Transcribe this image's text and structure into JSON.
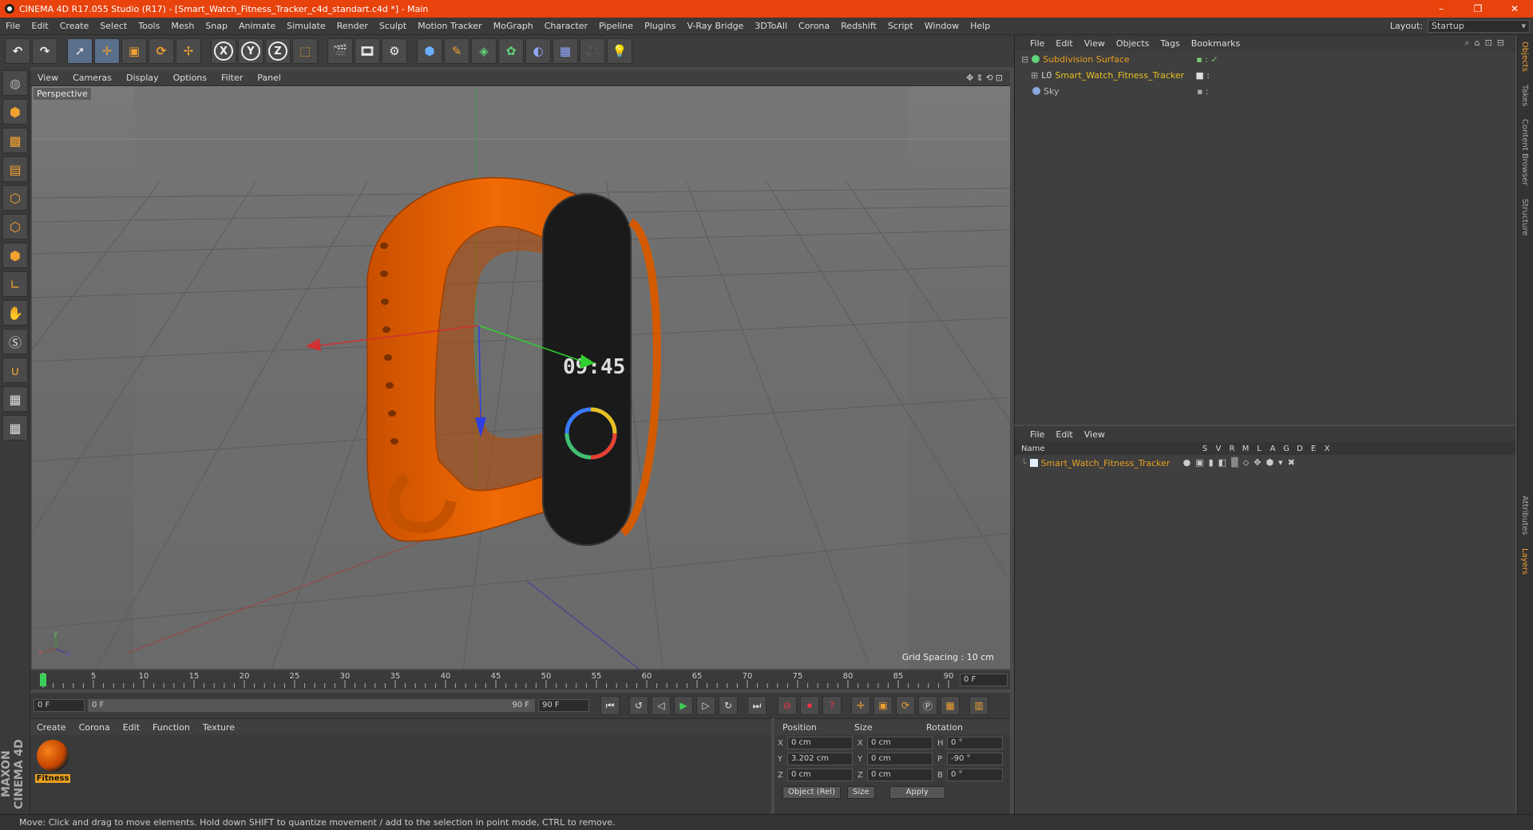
{
  "window": {
    "title": "CINEMA 4D R17.055 Studio (R17) - [Smart_Watch_Fitness_Tracker_c4d_standart.c4d *] - Main",
    "min": "–",
    "max": "❐",
    "close": "✕"
  },
  "menubar": {
    "items": [
      "File",
      "Edit",
      "Create",
      "Select",
      "Tools",
      "Mesh",
      "Snap",
      "Animate",
      "Simulate",
      "Render",
      "Sculpt",
      "Motion Tracker",
      "MoGraph",
      "Character",
      "Pipeline",
      "Plugins",
      "V-Ray Bridge",
      "3DToAll",
      "Corona",
      "Redshift",
      "Script",
      "Window",
      "Help"
    ],
    "layout_label": "Layout:",
    "layout_value": "Startup"
  },
  "toolbar": {
    "x": "X",
    "y": "Y",
    "z": "Z"
  },
  "viewport": {
    "menu": [
      "View",
      "Cameras",
      "Display",
      "Options",
      "Filter",
      "Panel"
    ],
    "camera": "Perspective",
    "grid_spacing": "Grid Spacing : 10 cm",
    "watch_time": "09:45"
  },
  "timeline": {
    "ticks": [
      "0",
      "5",
      "10",
      "15",
      "20",
      "25",
      "30",
      "35",
      "40",
      "45",
      "50",
      "55",
      "60",
      "65",
      "70",
      "75",
      "80",
      "85",
      "90"
    ],
    "end_field": "0 F",
    "start_frame": "0 F",
    "range_start": "0 F",
    "range_end": "90 F",
    "max_frame": "90 F"
  },
  "material_manager": {
    "menu": [
      "Create",
      "Corona",
      "Edit",
      "Function",
      "Texture"
    ],
    "material_name": "Fitness"
  },
  "coordinates": {
    "headers": [
      "Position",
      "Size",
      "Rotation"
    ],
    "rows": [
      {
        "pos_axis": "X",
        "pos": "0 cm",
        "size_axis": "X",
        "size": "0 cm",
        "rot_axis": "H",
        "rot": "0 °"
      },
      {
        "pos_axis": "Y",
        "pos": "3.202 cm",
        "size_axis": "Y",
        "size": "0 cm",
        "rot_axis": "P",
        "rot": "-90 °"
      },
      {
        "pos_axis": "Z",
        "pos": "0 cm",
        "size_axis": "Z",
        "size": "0 cm",
        "rot_axis": "B",
        "rot": "0 °"
      }
    ],
    "mode": "Object (Rel)",
    "size_mode": "Size",
    "apply": "Apply"
  },
  "object_manager": {
    "menu": [
      "File",
      "Edit",
      "View",
      "Objects",
      "Tags",
      "Bookmarks"
    ],
    "objects": [
      {
        "name": "Subdivision Surface",
        "color": "#e8a020"
      },
      {
        "name": "Smart_Watch_Fitness_Tracker",
        "color": "#e8c020"
      },
      {
        "name": "Sky",
        "color": "#bbbbbb"
      }
    ]
  },
  "layer_manager": {
    "menu": [
      "File",
      "Edit",
      "View"
    ],
    "name_header": "Name",
    "columns": [
      "S",
      "V",
      "R",
      "M",
      "L",
      "A",
      "G",
      "D",
      "E",
      "X"
    ],
    "layers": [
      {
        "name": "Smart_Watch_Fitness_Tracker"
      }
    ]
  },
  "side_tabs": [
    "Objects",
    "Takes",
    "Content Browser",
    "Structure",
    "Attributes",
    "Layers"
  ],
  "logo": "MAXON CINEMA 4D",
  "status": "Move: Click and drag to move elements. Hold down SHIFT to quantize movement / add to the selection in point mode, CTRL to remove.",
  "colors": {
    "accent": "#e8420d",
    "selection": "#f0a030"
  }
}
